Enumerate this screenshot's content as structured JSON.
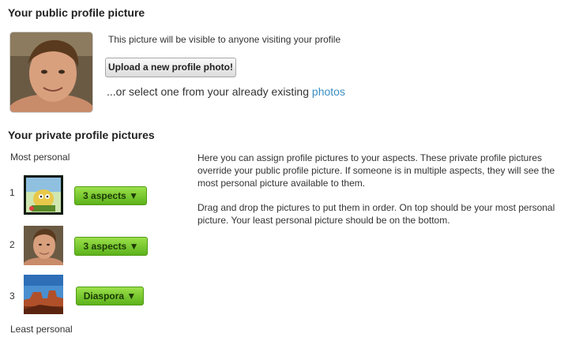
{
  "public": {
    "heading": "Your public profile picture",
    "visibility_text": "This picture will be visible to anyone visiting your profile",
    "upload_button": "Upload a new profile photo!",
    "select_prefix": "...or select one from your already existing ",
    "select_link": "photos"
  },
  "private": {
    "heading": "Your private profile pictures",
    "most_personal": "Most personal",
    "least_personal": "Least personal",
    "rows": [
      {
        "number": "1",
        "aspects_label": "3 aspects ▼"
      },
      {
        "number": "2",
        "aspects_label": "3 aspects ▼"
      },
      {
        "number": "3",
        "aspects_label": "Diaspora ▼"
      }
    ],
    "help_paragraph_1": "Here you can assign profile pictures to your aspects. These private profile pictures override your public profile picture. If someone is in multiple aspects, they will see the most personal picture available to them.",
    "help_paragraph_2": "Drag and drop the pictures to put them in order. On top should be your most personal picture. Your least personal picture should be on the bottom."
  },
  "colors": {
    "link": "#3b8ec2",
    "aspect_button_top": "#9be04a",
    "aspect_button_bottom": "#5cb21b"
  }
}
